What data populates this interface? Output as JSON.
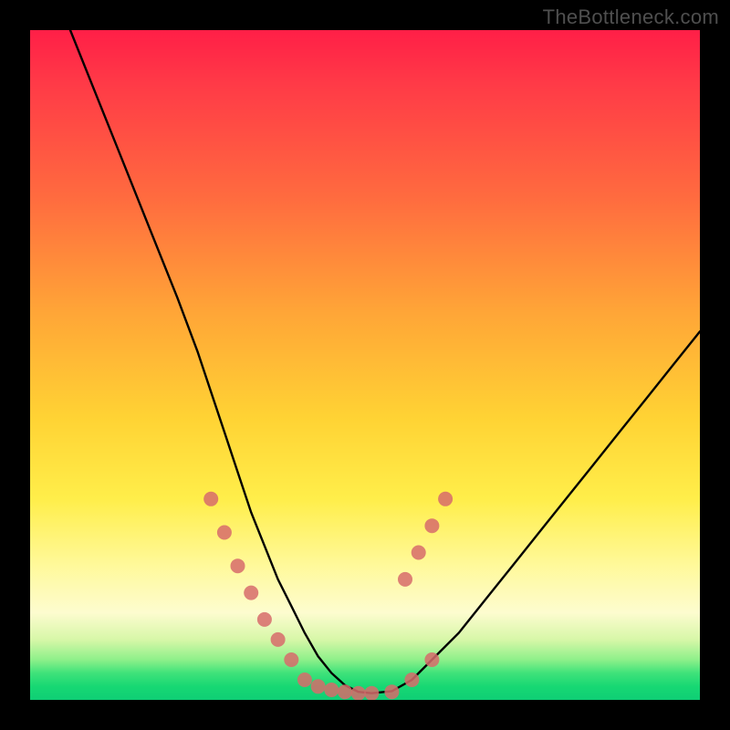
{
  "watermark": "TheBottleneck.com",
  "chart_data": {
    "type": "line",
    "title": "",
    "xlabel": "",
    "ylabel": "",
    "xlim": [
      0,
      100
    ],
    "ylim": [
      0,
      100
    ],
    "grid": false,
    "background_gradient": [
      "#ff1f47",
      "#ff6b3f",
      "#ffd334",
      "#fff99b",
      "#17d873"
    ],
    "series": [
      {
        "name": "bottleneck-curve",
        "x": [
          6,
          10,
          14,
          18,
          22,
          25,
          27,
          29,
          31,
          33,
          35,
          37,
          39,
          41,
          43,
          45,
          47,
          49,
          51,
          54,
          57,
          60,
          64,
          68,
          72,
          76,
          80,
          84,
          88,
          92,
          96,
          100
        ],
        "y": [
          100,
          90,
          80,
          70,
          60,
          52,
          46,
          40,
          34,
          28,
          23,
          18,
          14,
          10,
          6.5,
          4,
          2.2,
          1.2,
          1.0,
          1.3,
          3,
          6,
          10,
          15,
          20,
          25,
          30,
          35,
          40,
          45,
          50,
          55
        ]
      }
    ],
    "markers": {
      "name": "highlight-points",
      "color": "#d76b6b",
      "x": [
        27,
        29,
        31,
        33,
        35,
        37,
        39,
        41,
        43,
        45,
        47,
        49,
        51,
        54,
        57,
        60,
        56,
        58,
        60,
        62
      ],
      "y": [
        30,
        25,
        20,
        16,
        12,
        9,
        6,
        3,
        2,
        1.5,
        1.2,
        1.0,
        1.0,
        1.2,
        3,
        6,
        18,
        22,
        26,
        30
      ]
    }
  }
}
